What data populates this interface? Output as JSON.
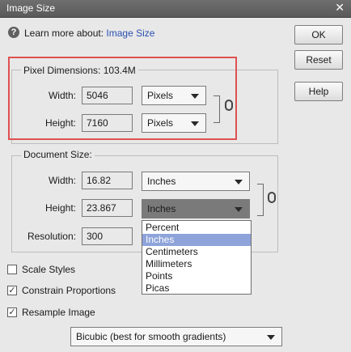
{
  "window": {
    "title": "Image Size",
    "close_glyph": "✕"
  },
  "learn": {
    "prefix": "Learn more about:",
    "link": "Image Size"
  },
  "buttons": {
    "ok": "OK",
    "reset": "Reset",
    "help": "Help"
  },
  "pixel_dimensions": {
    "legend": "Pixel Dimensions:",
    "size": "103.4M",
    "width_label": "Width:",
    "width_value": "5046",
    "width_unit": "Pixels",
    "height_label": "Height:",
    "height_value": "7160",
    "height_unit": "Pixels"
  },
  "document_size": {
    "legend": "Document Size:",
    "width_label": "Width:",
    "width_value": "16.82",
    "width_unit": "Inches",
    "height_label": "Height:",
    "height_value": "23.867",
    "height_unit": "Inches",
    "resolution_label": "Resolution:",
    "resolution_value": "300"
  },
  "unit_options": [
    "Percent",
    "Inches",
    "Centimeters",
    "Millimeters",
    "Points",
    "Picas"
  ],
  "unit_selected": "Inches",
  "checkboxes": {
    "scale_styles": {
      "label": "Scale Styles",
      "checked": false
    },
    "constrain": {
      "label": "Constrain Proportions",
      "checked": true
    },
    "resample": {
      "label": "Resample Image",
      "checked": true
    }
  },
  "resample_method": "Bicubic (best for smooth gradients)",
  "colors": {
    "highlight": "#e05050",
    "selection": "#8da3d9",
    "link": "#2a4fb2"
  },
  "icons": {
    "info": "info-icon",
    "link": "chain-link-icon",
    "dropdown": "chevron-down-icon"
  }
}
